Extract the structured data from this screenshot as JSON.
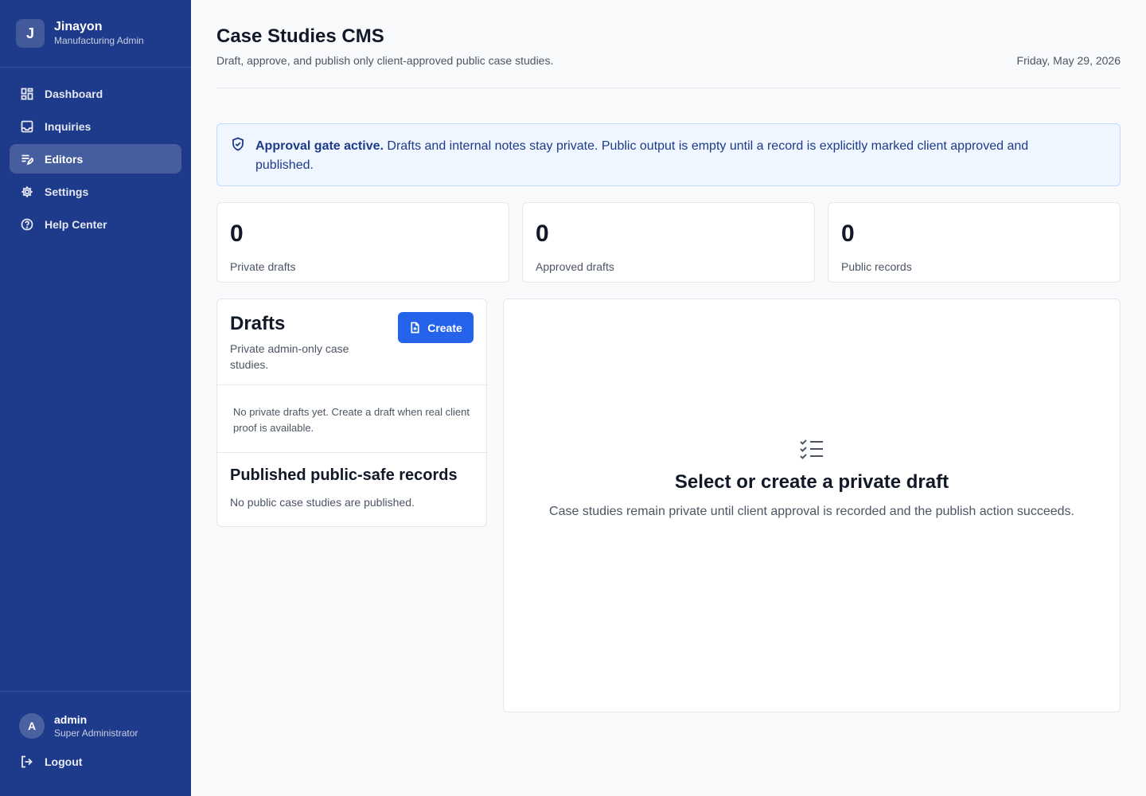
{
  "brand": {
    "initial": "J",
    "name": "Jinayon",
    "subtitle": "Manufacturing Admin"
  },
  "nav": [
    {
      "label": "Dashboard",
      "icon": "dashboard-icon",
      "active": false
    },
    {
      "label": "Inquiries",
      "icon": "inbox-icon",
      "active": false
    },
    {
      "label": "Editors",
      "icon": "edit-list-icon",
      "active": true
    },
    {
      "label": "Settings",
      "icon": "gear-icon",
      "active": false
    },
    {
      "label": "Help Center",
      "icon": "help-icon",
      "active": false
    }
  ],
  "user": {
    "initial": "A",
    "name": "admin",
    "role": "Super Administrator"
  },
  "logout_label": "Logout",
  "header": {
    "title": "Case Studies CMS",
    "subtitle": "Draft, approve, and publish only client-approved public case studies.",
    "date": "Friday, May 29, 2026"
  },
  "notice": {
    "strong": "Approval gate active.",
    "text": " Drafts and internal notes stay private. Public output is empty until a record is explicitly marked client approved and published."
  },
  "stats": [
    {
      "value": "0",
      "label": "Private drafts"
    },
    {
      "value": "0",
      "label": "Approved drafts"
    },
    {
      "value": "0",
      "label": "Public records"
    }
  ],
  "drafts": {
    "title": "Drafts",
    "subtitle": "Private admin-only case studies.",
    "create_label": "Create",
    "empty": "No private drafts yet. Create a draft when real client proof is available."
  },
  "published": {
    "title": "Published public-safe records",
    "empty": "No public case studies are published."
  },
  "detail": {
    "title": "Select or create a private draft",
    "subtitle": "Case studies remain private until client approval is recorded and the publish action succeeds."
  },
  "colors": {
    "sidebar": "#1e3a8a",
    "accent": "#2563eb",
    "notice_bg": "#eff6ff",
    "notice_border": "#bfdbfe"
  }
}
